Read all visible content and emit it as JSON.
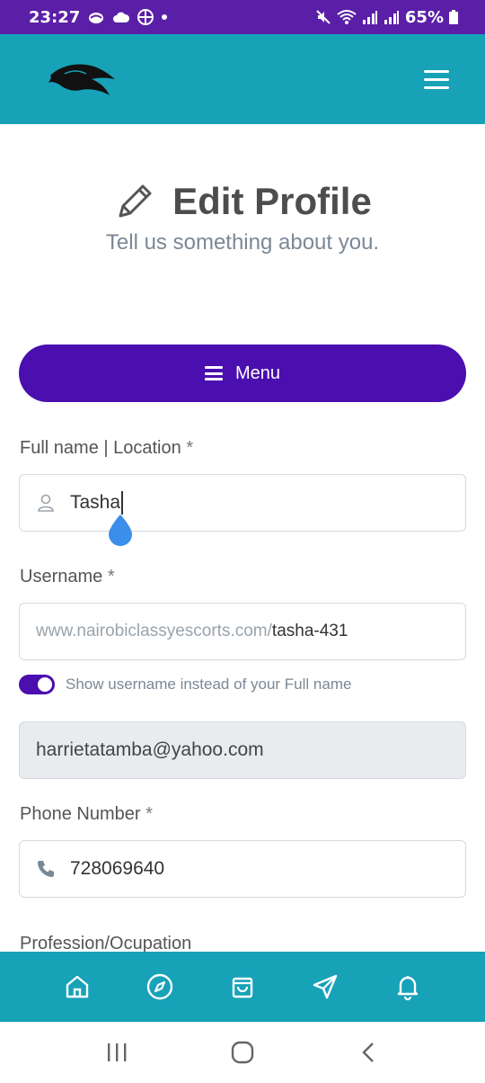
{
  "status_bar": {
    "time": "23:27",
    "battery": "65%"
  },
  "header": {
    "logo_icon": "horse-logo-icon",
    "menu_icon": "hamburger-icon"
  },
  "page": {
    "title": "Edit Profile",
    "subtitle": "Tell us something about you."
  },
  "menu_button": {
    "label": "Menu"
  },
  "form": {
    "fullname": {
      "label": "Full name | Location",
      "required": "*",
      "value": "Tasha"
    },
    "username": {
      "label": "Username",
      "required": "*",
      "prefix": "www.nairobiclassyescorts.com/",
      "value": "tasha-431"
    },
    "toggle": {
      "label": "Show username instead of your Full name",
      "on": true
    },
    "email": {
      "value": "harrietatamba@yahoo.com"
    },
    "phone": {
      "label": "Phone Number",
      "required": "*",
      "value": "728069640"
    },
    "profession": {
      "label": "Profession/Ocupation"
    }
  },
  "bottom_nav": [
    "home-icon",
    "compass-icon",
    "shopping-bag-icon",
    "send-icon",
    "bell-icon"
  ],
  "android_nav": [
    "recent-apps-icon",
    "home-circle-icon",
    "back-icon"
  ],
  "colors": {
    "primary": "#4a0fae",
    "header": "#17a2b8",
    "status_bar": "#5a1fa6"
  }
}
